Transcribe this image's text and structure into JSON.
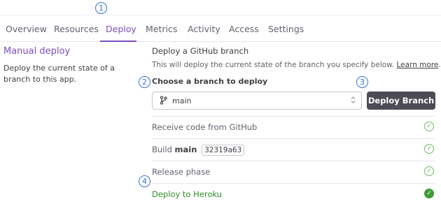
{
  "callouts": [
    "1",
    "2",
    "3",
    "4"
  ],
  "tabs": [
    {
      "label": "Overview"
    },
    {
      "label": "Resources"
    },
    {
      "label": "Deploy"
    },
    {
      "label": "Metrics"
    },
    {
      "label": "Activity"
    },
    {
      "label": "Access"
    },
    {
      "label": "Settings"
    }
  ],
  "active_tab": "Deploy",
  "manual_deploy": {
    "title": "Manual deploy",
    "description": "Deploy the current state of a branch to this app."
  },
  "github": {
    "title": "Deploy a GitHub branch",
    "description": "This will deploy the current state of the branch you specify below.",
    "learn_more": "Learn more",
    "description_end": "."
  },
  "branch_select": {
    "label": "Choose a branch to deploy",
    "value": "main"
  },
  "deploy_button": {
    "label": "Deploy Branch"
  },
  "steps": [
    {
      "label": "Receive code from GitHub",
      "status": "done"
    },
    {
      "label_prefix": "Build",
      "branch": "main",
      "commit": "32319a63",
      "status": "done"
    },
    {
      "label": "Release phase",
      "status": "done"
    },
    {
      "label": "Deploy to Heroku",
      "status": "success"
    }
  ],
  "colors": {
    "accent_purple": "#7a4ec2",
    "callout_blue": "#3a6fd8",
    "button_dark": "#4b4c55",
    "success_green": "#3f9b35"
  },
  "icons": {
    "branch": "git-branch-icon",
    "chevron": "chevron-updown-icon",
    "check": "check-circle-icon"
  }
}
